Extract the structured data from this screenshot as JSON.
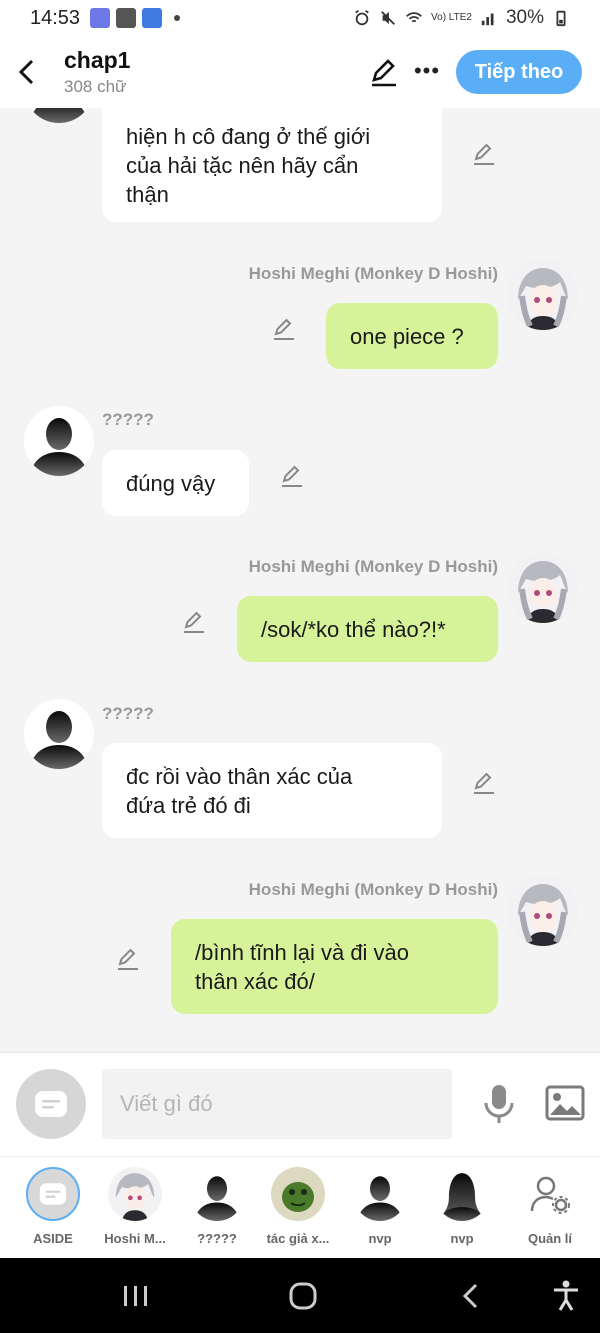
{
  "status_bar": {
    "time": "14:53",
    "battery": "30%",
    "network": "Vo) LTE2"
  },
  "header": {
    "title": "chap1",
    "subtitle": "308 chữ",
    "next_label": "Tiếp theo"
  },
  "messages": [
    {
      "side": "left",
      "name": "",
      "text": "hiện h cô đang ở thế giới\ncủa hải tặc nên hãy cẩn\nthận"
    },
    {
      "side": "right",
      "name": "Hoshi Meghi (Monkey D Hoshi)",
      "text": "one piece ?"
    },
    {
      "side": "left",
      "name": "?????",
      "text": "đúng vậy"
    },
    {
      "side": "right",
      "name": "Hoshi Meghi (Monkey D Hoshi)",
      "text": "/sok/*ko thể nào?!*"
    },
    {
      "side": "left",
      "name": "?????",
      "text": "đc rồi vào thân xác của\nđứa trẻ đó đi"
    },
    {
      "side": "right",
      "name": "Hoshi Meghi (Monkey D Hoshi)",
      "text": "/bình tĩnh lại và đi vào\nthân xác đó/"
    }
  ],
  "input": {
    "placeholder": "Viết gì đó"
  },
  "characters": [
    {
      "label": "ASIDE",
      "icon": "aside-icon"
    },
    {
      "label": "Hoshi M...",
      "icon": "anime-avatar"
    },
    {
      "label": "?????",
      "icon": "silhouette-avatar"
    },
    {
      "label": "tác giả x...",
      "icon": "green-creature-avatar"
    },
    {
      "label": "nvp",
      "icon": "silhouette-avatar"
    },
    {
      "label": "nvp",
      "icon": "long-hair-silhouette-avatar"
    },
    {
      "label": "Quản lí",
      "icon": "manage-user-icon"
    }
  ],
  "colors": {
    "accent": "#5aaef5",
    "green_bubble": "#d6f39a",
    "white_bubble": "#ffffff",
    "background": "#f4f4f4"
  }
}
